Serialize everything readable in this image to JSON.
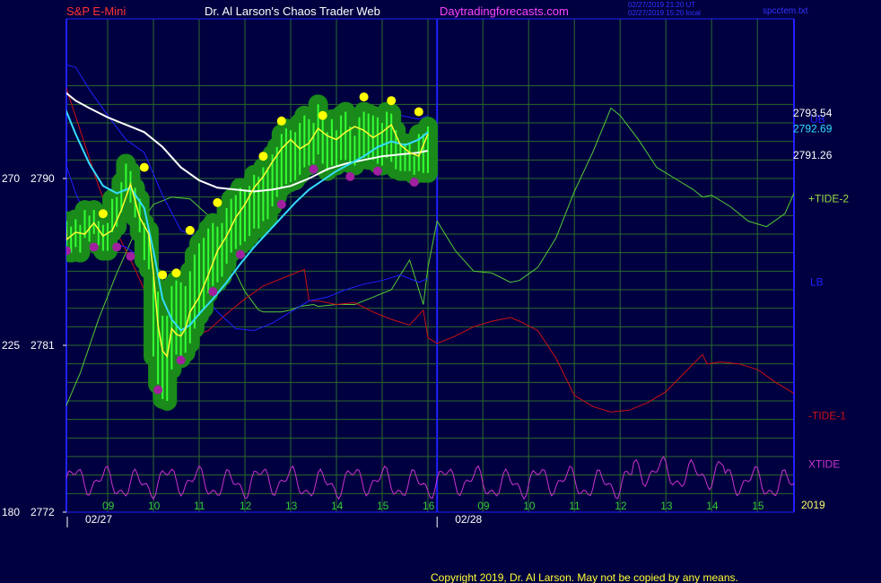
{
  "header": {
    "symbol": "S&P E-Mini",
    "title": "Dr. Al Larson's Chaos Trader Web",
    "site": "Daytradingforecasts.com",
    "stamp_utc": "02/27/2019 21:20 UT",
    "stamp_local": "02/27/2019 15:20 local",
    "file": "spcctem.txt"
  },
  "footer": {
    "copyright": "Copyright 2019, Dr. Al Larson. May not be copied by any means."
  },
  "colors": {
    "background": "#000040",
    "grid": "#2a6a2a",
    "frame": "#2020ff",
    "price_bar": "#33ff33",
    "price_bar_glow": "#1a8a1a",
    "high_marker": "#ffff00",
    "low_marker": "#a020a0",
    "fast_average": "#ffff33",
    "medium_average": "#33ddff",
    "slow_average": "#ffffff",
    "band": "#2020ff",
    "tide_plus": "#55cc33",
    "tide_minus": "#cc1111",
    "xtide": "#cc33cc",
    "title_red": "#ff3333",
    "title_white": "#ffffff",
    "title_magenta": "#ff44ff",
    "stamp_blue": "#3333ff"
  },
  "chart_data": {
    "type": "line",
    "x_axis": {
      "unit": "hour",
      "range": [
        8,
        16.2
      ],
      "hour_ticks": [
        "09",
        "10",
        "11",
        "12",
        "13",
        "14",
        "15",
        "16"
      ],
      "day2_hour_ticks": [
        "09",
        "10",
        "11",
        "12",
        "13",
        "14",
        "15",
        "16"
      ],
      "date_labels": [
        "02/27",
        "02/28"
      ],
      "year_label": "2019"
    },
    "y_axis": {
      "ylim": [
        2772,
        2795
      ],
      "ticks": [
        {
          "left": "270",
          "value": 2790
        },
        {
          "left": "225",
          "value": 2781
        },
        {
          "left": "180",
          "value": 2772
        }
      ]
    },
    "last_values": [
      {
        "text": "2793.54",
        "value": 2793.54,
        "color": "#ffffff"
      },
      {
        "text": "2792.69",
        "value": 2792.69,
        "color": "#33ddff"
      },
      {
        "text": "2791.26",
        "value": 2791.26,
        "color": "#ffffff"
      }
    ],
    "right_labels": [
      {
        "text": "UB",
        "color": "#2020ff",
        "value": 2793.2
      },
      {
        "text": "+TIDE-2",
        "color": "#99dd44",
        "value": 2788.9
      },
      {
        "text": "LB",
        "color": "#2020ff",
        "value": 2784.4
      },
      {
        "text": "-TIDE-1",
        "color": "#cc1111",
        "value": 2777.2
      },
      {
        "text": "XTIDE",
        "color": "#cc33cc",
        "value": 2774.6
      }
    ],
    "grid": true,
    "price": {
      "x": [
        8,
        8.1,
        8.2,
        8.3,
        8.4,
        8.5,
        8.6,
        8.7,
        8.8,
        8.9,
        9,
        9.1,
        9.2,
        9.3,
        9.4,
        9.5,
        9.6,
        9.7,
        9.8,
        9.9,
        10,
        10.1,
        10.2,
        10.3,
        10.4,
        10.5,
        10.6,
        10.7,
        10.8,
        10.9,
        11,
        11.1,
        11.2,
        11.3,
        11.4,
        11.5,
        11.6,
        11.7,
        11.8,
        11.9,
        12,
        12.1,
        12.2,
        12.3,
        12.4,
        12.5,
        12.6,
        12.7,
        12.8,
        12.9,
        13,
        13.1,
        13.2,
        13.3,
        13.4,
        13.5,
        13.6,
        13.7,
        13.8,
        13.9,
        14,
        14.1,
        14.2,
        14.3,
        14.4,
        14.5,
        14.6,
        14.7,
        14.8,
        14.9,
        15,
        15.1,
        15.2,
        15.3,
        15.4,
        15.5,
        15.6,
        15.7,
        15.8,
        15.9,
        16
      ],
      "high": [
        2787.6,
        2787.7,
        2787.4,
        2787.8,
        2787.5,
        2788.3,
        2788,
        2788.3,
        2787.7,
        2787.5,
        2787.6,
        2788.9,
        2789,
        2789.8,
        2790.8,
        2790.4,
        2789.5,
        2788.9,
        2787.6,
        2787.2,
        2784.7,
        2783.9,
        2782.6,
        2782.6,
        2784.2,
        2784.5,
        2784.4,
        2784.2,
        2785,
        2785.9,
        2786.5,
        2786.8,
        2787.3,
        2787.6,
        2787.4,
        2787.6,
        2788.4,
        2788.9,
        2789.1,
        2789.5,
        2789.4,
        2789.6,
        2790.2,
        2790.1,
        2790.6,
        2790.6,
        2791.3,
        2791.7,
        2792.4,
        2792.7,
        2792.6,
        2792.5,
        2793,
        2793.4,
        2793.2,
        2793,
        2794,
        2793.2,
        2792.5,
        2793.2,
        2792.6,
        2793.4,
        2793.6,
        2792.8,
        2792.3,
        2793.3,
        2793.6,
        2793.5,
        2793.4,
        2793.3,
        2793,
        2793.6,
        2793.5,
        2792.6,
        2791.8,
        2791.9,
        2791.9,
        2791.2,
        2792.4,
        2792.4,
        2792.8
      ],
      "low": [
        2786.2,
        2786.3,
        2786,
        2786.3,
        2786,
        2786.8,
        2786.6,
        2787,
        2786.4,
        2786.1,
        2786.1,
        2787.1,
        2787.4,
        2788.2,
        2789.3,
        2788.7,
        2787.9,
        2787.1,
        2785.6,
        2785.1,
        2780.4,
        2778.9,
        2778.1,
        2778,
        2779.7,
        2780.5,
        2780.3,
        2780.6,
        2781.1,
        2781.9,
        2782.6,
        2783,
        2783.8,
        2784.2,
        2784.4,
        2784.7,
        2785.4,
        2786,
        2786.2,
        2786.4,
        2786.6,
        2786.9,
        2787.3,
        2787.3,
        2787.7,
        2787.8,
        2788.5,
        2789,
        2789.5,
        2789.7,
        2789.8,
        2789.9,
        2790.2,
        2790.6,
        2790.7,
        2790.8,
        2791.3,
        2790.8,
        2790.4,
        2790.7,
        2790.7,
        2791,
        2791,
        2790.8,
        2790.7,
        2791,
        2791.1,
        2791,
        2791,
        2790.8,
        2790.7,
        2791.1,
        2790.9,
        2790.5,
        2790.4,
        2790.4,
        2790.4,
        2790.2,
        2790.4,
        2790.3,
        2790.3
      ],
      "swing_high_x": [
        8.9,
        9.8,
        10.2,
        10.5,
        10.8,
        11.4,
        12.4,
        12.8,
        13.7,
        14.6,
        15.2,
        15.8
      ],
      "swing_high_y": [
        2788.1,
        2790.6,
        2784.8,
        2784.9,
        2787.2,
        2788.7,
        2791.2,
        2793.1,
        2793.4,
        2794.4,
        2794.2,
        2793.6
      ],
      "swing_low_x": [
        8.1,
        8.7,
        9.2,
        9.5,
        10.1,
        10.6,
        11.3,
        11.9,
        12.8,
        13.5,
        14.3,
        14.9,
        15.7
      ],
      "swing_low_y": [
        2786.1,
        2786.3,
        2786.3,
        2785.8,
        2778.6,
        2780.2,
        2783.9,
        2785.9,
        2788.6,
        2790.5,
        2790.1,
        2790.4,
        2789.8
      ]
    },
    "fast_average": {
      "x": [
        8,
        8.1,
        8.3,
        8.5,
        8.7,
        8.9,
        9.1,
        9.3,
        9.5,
        9.7,
        9.9,
        10,
        10.1,
        10.2,
        10.3,
        10.4,
        10.5,
        10.6,
        10.7,
        10.8,
        11,
        11.2,
        11.4,
        11.6,
        11.8,
        12,
        12.2,
        12.4,
        12.6,
        12.8,
        13,
        13.2,
        13.4,
        13.6,
        13.8,
        14,
        14.2,
        14.4,
        14.6,
        14.8,
        15,
        15.2,
        15.4,
        15.6,
        15.8,
        16
      ],
      "y": [
        2791.4,
        2786.7,
        2787.1,
        2787,
        2787.6,
        2786.9,
        2787.2,
        2788.3,
        2789.7,
        2787.9,
        2787,
        2784.9,
        2782.1,
        2780.7,
        2780.4,
        2781.9,
        2781.6,
        2781.5,
        2781.9,
        2782.8,
        2783.6,
        2784.8,
        2786.1,
        2786.9,
        2787.9,
        2788.6,
        2789.5,
        2790.1,
        2790.9,
        2791.6,
        2792.1,
        2791.6,
        2791.9,
        2792.7,
        2792.3,
        2792.1,
        2792.5,
        2792.8,
        2792.6,
        2792.2,
        2792.5,
        2792.9,
        2791.8,
        2791.4,
        2791.2,
        2792.4
      ]
    },
    "medium_average": {
      "x": [
        8,
        8.3,
        8.6,
        8.9,
        9.2,
        9.5,
        9.8,
        10,
        10.2,
        10.4,
        10.6,
        10.8,
        11,
        11.3,
        11.6,
        11.9,
        12.2,
        12.5,
        12.8,
        13.1,
        13.4,
        13.7,
        14,
        14.3,
        14.6,
        14.9,
        15.2,
        15.5,
        15.8,
        16
      ],
      "y": [
        2794.2,
        2792.4,
        2790.8,
        2789.6,
        2789.2,
        2789.5,
        2788.4,
        2786.1,
        2783.5,
        2782.4,
        2781.8,
        2782.1,
        2782.7,
        2783.5,
        2784.4,
        2785.4,
        2786.3,
        2787.1,
        2787.9,
        2788.7,
        2789.4,
        2789.9,
        2790.4,
        2790.8,
        2791.2,
        2791.7,
        2792,
        2791.8,
        2792.1,
        2792.5
      ]
    },
    "slow_average": {
      "x": [
        8,
        8.3,
        8.6,
        9,
        9.4,
        9.8,
        10.2,
        10.6,
        11,
        11.4,
        11.8,
        12.2,
        12.6,
        13,
        13.4,
        13.8,
        14.2,
        14.6,
        15,
        15.4,
        15.8,
        16
      ],
      "y": [
        2794.8,
        2794.2,
        2793.8,
        2793.3,
        2792.9,
        2792.5,
        2791.7,
        2790.6,
        2789.9,
        2789.5,
        2789.4,
        2789.3,
        2789.4,
        2789.6,
        2790,
        2790.5,
        2790.8,
        2791,
        2791.2,
        2791.3,
        2791.4,
        2791.5
      ]
    },
    "upper_band": {
      "x": [
        8,
        8.3,
        8.6,
        9,
        9.4,
        9.8,
        10.2,
        10.6,
        11,
        11.4,
        11.8,
        12.2,
        12.6,
        13,
        13.4,
        13.8,
        14.2,
        14.6,
        15,
        15.4,
        15.8,
        16
      ],
      "y": [
        2796.2,
        2796,
        2794.8,
        2793.4,
        2792.1,
        2791.4,
        2789.1,
        2787.2,
        2786.8,
        2787.5,
        2788.5,
        2789.4,
        2790.3,
        2791.1,
        2792,
        2792.8,
        2793.2,
        2793.5,
        2793.6,
        2793.4,
        2793.2,
        2793.4
      ]
    },
    "lower_band": {
      "x": [
        8,
        8.3,
        8.6,
        9,
        9.4,
        9.8,
        10.2,
        10.6,
        11,
        11.4,
        11.8,
        12.2,
        12.6,
        13,
        13.4,
        13.8,
        14.2,
        14.6,
        15,
        15.4,
        15.8,
        16
      ],
      "y": [
        2791.4,
        2789.2,
        2787.6,
        2786.6,
        2786.3,
        2785.6,
        2784.7,
        2784.5,
        2784,
        2782.8,
        2781.9,
        2781.8,
        2782.2,
        2782.8,
        2783.4,
        2783.6,
        2784,
        2784.3,
        2784.5,
        2784.8,
        2784.4,
        2784.6
      ]
    },
    "tide_plus": {
      "name": "+TIDE-2",
      "x": [
        8,
        8.4,
        8.8,
        9.2,
        9.6,
        10,
        10.4,
        10.8,
        11.2,
        11.6,
        12,
        12.3,
        12.4,
        12.6,
        12.8,
        13,
        13.2,
        13.5,
        13.6,
        14,
        14.4,
        14.8,
        15.2,
        15.6,
        15.9,
        16,
        16.2,
        16.6,
        17,
        17.4,
        17.8,
        18,
        18.4,
        18.8,
        19.2,
        19.6,
        20,
        20.1,
        20.2,
        20.6,
        21,
        21.4,
        21.8,
        22,
        22.2,
        22.6,
        22.9,
        23,
        23.4,
        23.8,
        24,
        24.2
      ],
      "y": [
        2777.2,
        2779.5,
        2782.4,
        2784.9,
        2787.1,
        2788.6,
        2789,
        2788.9,
        2788,
        2785.9,
        2783.9,
        2782.9,
        2782.8,
        2782.8,
        2782.8,
        2782.9,
        2783.1,
        2783.2,
        2783.1,
        2783.2,
        2783.2,
        2783.6,
        2784,
        2785.6,
        2783.2,
        2785.2,
        2787.7,
        2786.1,
        2785,
        2784.9,
        2784.4,
        2784.5,
        2785.2,
        2786.8,
        2789.3,
        2791.4,
        2793.8,
        2793.6,
        2793.4,
        2792.1,
        2790.6,
        2790,
        2789.4,
        2789,
        2789.1,
        2788.5,
        2787.9,
        2787.7,
        2787.4,
        2788.1,
        2789.2,
        2791.2
      ]
    },
    "tide_minus": {
      "name": "-TIDE-1",
      "x": [
        8,
        8.4,
        8.8,
        9.2,
        9.6,
        10,
        10.4,
        10.8,
        11.2,
        11.6,
        12,
        12.4,
        12.8,
        13,
        13.3,
        13.4,
        13.6,
        14,
        14.4,
        14.8,
        15.2,
        15.6,
        15.9,
        16,
        16.2,
        16.6,
        17,
        17.4,
        17.8,
        18,
        18.4,
        18.8,
        19.2,
        19.6,
        20,
        20.4,
        20.8,
        21.2,
        21.6,
        22,
        22.1,
        22.4,
        22.8,
        23.2,
        23.6,
        24,
        24.2
      ],
      "y": [
        2795.6,
        2792.6,
        2789.6,
        2787.1,
        2785.1,
        2782.9,
        2781.8,
        2781.4,
        2781.8,
        2782.7,
        2783.5,
        2784.2,
        2784.6,
        2784.8,
        2785.1,
        2783.4,
        2783.4,
        2783.2,
        2783.3,
        2782.8,
        2782.4,
        2782.1,
        2782.9,
        2781.4,
        2781.1,
        2781.5,
        2782,
        2782.3,
        2782.5,
        2782.3,
        2781.8,
        2780.3,
        2778.3,
        2777.7,
        2777.4,
        2777.5,
        2777.9,
        2778.5,
        2779.5,
        2780.5,
        2780,
        2780.1,
        2780,
        2779.7,
        2779,
        2778.4,
        2778.2
      ]
    },
    "xtide": {
      "name": "XTIDE",
      "amplitude": 1.1,
      "center": 2773.6
    }
  }
}
